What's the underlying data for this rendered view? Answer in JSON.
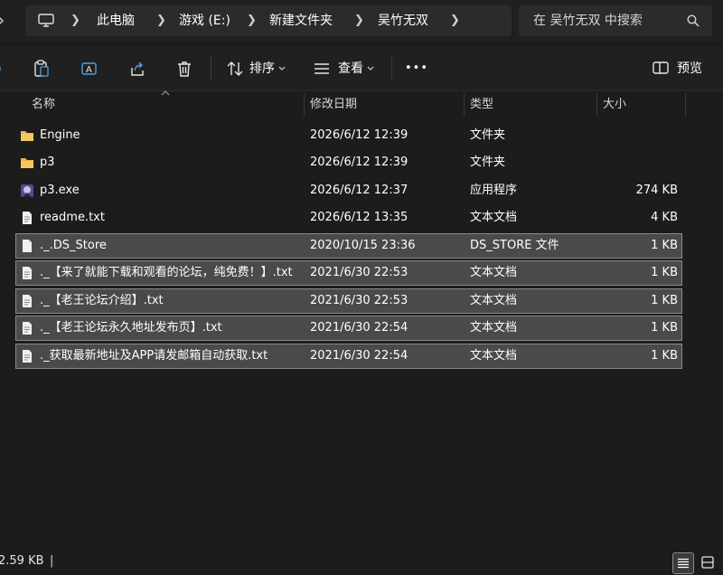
{
  "breadcrumb": [
    "此电脑",
    "游戏 (E:)",
    "新建文件夹",
    "吴竹无双"
  ],
  "search": {
    "placeholder": "在 吴竹无双 中搜索"
  },
  "toolbar": {
    "sort_label": "排序",
    "view_label": "查看",
    "more_label": "•••",
    "preview_label": "预览"
  },
  "columns": {
    "name": "名称",
    "date": "修改日期",
    "type": "类型",
    "size": "大小"
  },
  "files": [
    {
      "name": "Engine",
      "date": "2026/6/12 12:39",
      "type": "文件夹",
      "size": "",
      "icon": "folder-icon",
      "selected": false
    },
    {
      "name": "p3",
      "date": "2026/6/12 12:39",
      "type": "文件夹",
      "size": "",
      "icon": "folder-icon",
      "selected": false
    },
    {
      "name": "p3.exe",
      "date": "2026/6/12 12:37",
      "type": "应用程序",
      "size": "274 KB",
      "icon": "exe-icon",
      "selected": false
    },
    {
      "name": "readme.txt",
      "date": "2026/6/12 13:35",
      "type": "文本文档",
      "size": "4 KB",
      "icon": "text-file-icon",
      "selected": false
    },
    {
      "name": "._.DS_Store",
      "date": "2020/10/15 23:36",
      "type": "DS_STORE 文件",
      "size": "1 KB",
      "icon": "file-icon",
      "selected": true
    },
    {
      "name": "._【来了就能下载和观看的论坛，纯免费！】.txt",
      "date": "2021/6/30 22:53",
      "type": "文本文档",
      "size": "1 KB",
      "icon": "text-file-icon",
      "selected": true
    },
    {
      "name": "._【老王论坛介绍】.txt",
      "date": "2021/6/30 22:53",
      "type": "文本文档",
      "size": "1 KB",
      "icon": "text-file-icon",
      "selected": true
    },
    {
      "name": "._【老王论坛永久地址发布页】.txt",
      "date": "2021/6/30 22:54",
      "type": "文本文档",
      "size": "1 KB",
      "icon": "text-file-icon",
      "selected": true
    },
    {
      "name": "._获取最新地址及APP请发邮箱自动获取.txt",
      "date": "2021/6/30 22:54",
      "type": "文本文档",
      "size": "1 KB",
      "icon": "text-file-icon",
      "selected": true
    }
  ],
  "status": {
    "size_text": "2.59 KB",
    "divider": "|"
  },
  "colors": {
    "background": "#1c1c1c",
    "bar": "#202020",
    "selection": "#4a4a4a",
    "folder": "#f2b544"
  }
}
